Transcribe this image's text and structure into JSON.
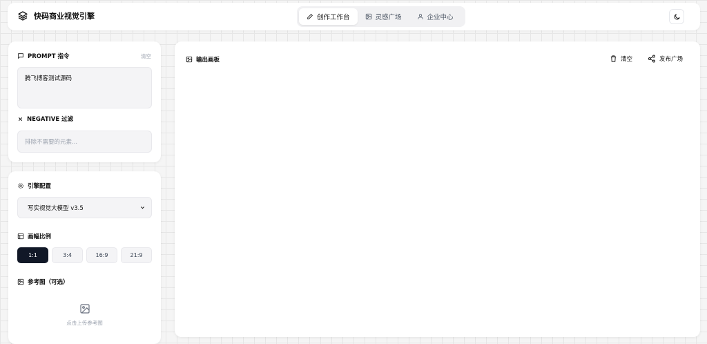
{
  "app": {
    "title": "快码商业视觉引擎"
  },
  "nav": {
    "tabs": [
      {
        "label": "创作工作台",
        "icon": "pencil-icon",
        "active": true
      },
      {
        "label": "灵感广场",
        "icon": "image-icon",
        "active": false
      },
      {
        "label": "企业中心",
        "icon": "user-icon",
        "active": false
      }
    ]
  },
  "prompt": {
    "title": "PROMPT 指令",
    "clear_label": "清空",
    "value": "腾飞博客测试源码",
    "negative_title": "NEGATIVE 过滤",
    "negative_placeholder": "排除不需要的元素..."
  },
  "config": {
    "title": "引擎配置",
    "model_selected": "写实视觉大模型 v3.5",
    "ratio_title": "画幅比例",
    "ratios": [
      "1:1",
      "3:4",
      "16:9",
      "21:9"
    ],
    "ratio_active": "1:1",
    "reference_title": "参考图（可选）",
    "upload_hint": "点击上传参考图"
  },
  "output": {
    "title": "输出画板",
    "clear_label": "清空",
    "publish_label": "发布广场"
  }
}
